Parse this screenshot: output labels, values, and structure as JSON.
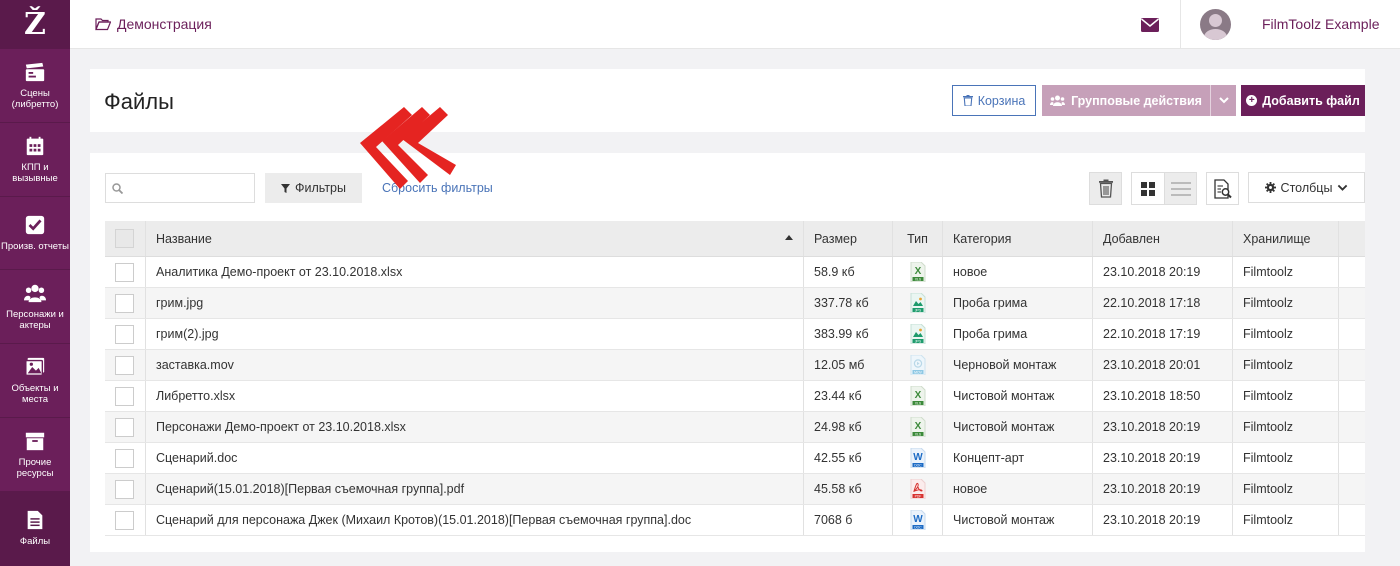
{
  "sidebar": {
    "logo": "Ž",
    "items": [
      {
        "label": "Сцены (либретто)",
        "icon": "clapperboard-icon"
      },
      {
        "label": "КПП и вызывные",
        "icon": "calendar-icon"
      },
      {
        "label": "Произв. отчеты",
        "icon": "check-square-icon"
      },
      {
        "label": "Персонажи и актеры",
        "icon": "users-icon"
      },
      {
        "label": "Объекты и места",
        "icon": "image-icon"
      },
      {
        "label": "Прочие ресурсы",
        "icon": "archive-icon"
      },
      {
        "label": "Файлы",
        "icon": "file-icon"
      }
    ]
  },
  "topbar": {
    "breadcrumb": "Демонстрация",
    "username": "FilmToolz Example"
  },
  "header": {
    "title": "Файлы",
    "trash_label": "Корзина",
    "group_actions_label": "Групповые действия",
    "add_file_label": "Добавить файл"
  },
  "toolbar": {
    "search_placeholder": "",
    "filters_label": "Фильтры",
    "reset_filters_label": "Сбросить фильтры",
    "columns_label": "Столбцы"
  },
  "colors": {
    "brand": "#6b1f5a",
    "brand_light": "#c6a0b9",
    "link": "#4a74b8",
    "annotation_arrow": "#e52421"
  },
  "table": {
    "columns": [
      "Название",
      "Размер",
      "Тип",
      "Категория",
      "Добавлен",
      "Хранилище"
    ],
    "rows": [
      {
        "name": "Аналитика Демо-проект от 23.10.2018.xlsx",
        "size": "58.9 кб",
        "type": "xls",
        "category": "новое",
        "added": "23.10.2018 20:19",
        "storage": "Filmtoolz"
      },
      {
        "name": "грим.jpg",
        "size": "337.78 кб",
        "type": "jpg",
        "category": "Проба грима",
        "added": "22.10.2018 17:18",
        "storage": "Filmtoolz"
      },
      {
        "name": "грим(2).jpg",
        "size": "383.99 кб",
        "type": "jpg",
        "category": "Проба грима",
        "added": "22.10.2018 17:19",
        "storage": "Filmtoolz"
      },
      {
        "name": "заставка.mov",
        "size": "12.05 мб",
        "type": "mov",
        "category": "Черновой монтаж",
        "added": "23.10.2018 20:01",
        "storage": "Filmtoolz"
      },
      {
        "name": "Либретто.xlsx",
        "size": "23.44 кб",
        "type": "xls",
        "category": "Чистовой монтаж",
        "added": "23.10.2018 18:50",
        "storage": "Filmtoolz"
      },
      {
        "name": "Персонажи Демо-проект от 23.10.2018.xlsx",
        "size": "24.98 кб",
        "type": "xls",
        "category": "Чистовой монтаж",
        "added": "23.10.2018 20:19",
        "storage": "Filmtoolz"
      },
      {
        "name": "Сценарий.doc",
        "size": "42.55 кб",
        "type": "doc",
        "category": "Концепт-арт",
        "added": "23.10.2018 20:19",
        "storage": "Filmtoolz"
      },
      {
        "name": "Сценарий(15.01.2018)[Первая съемочная группа].pdf",
        "size": "45.58 кб",
        "type": "pdf",
        "category": "новое",
        "added": "23.10.2018 20:19",
        "storage": "Filmtoolz"
      },
      {
        "name": "Сценарий для персонажа Джек (Михаил Кротов)(15.01.2018)[Первая съемочная группа].doc",
        "size": "7068 б",
        "type": "doc",
        "category": "Чистовой монтаж",
        "added": "23.10.2018 20:19",
        "storage": "Filmtoolz"
      }
    ]
  }
}
